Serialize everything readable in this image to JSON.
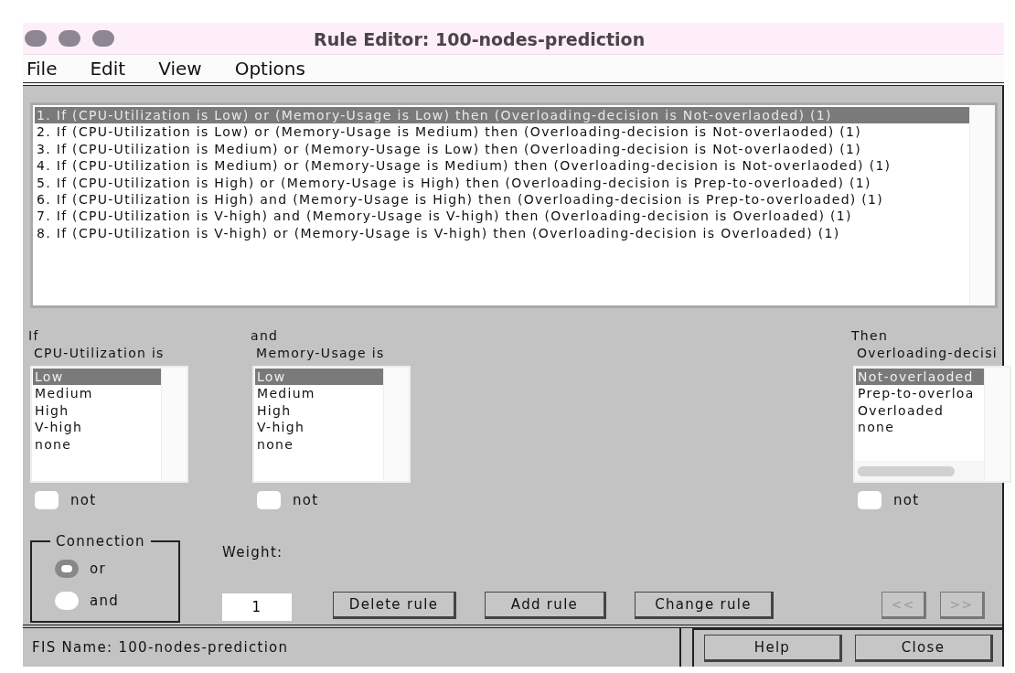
{
  "window": {
    "title": "Rule Editor: 100-nodes-prediction"
  },
  "menu": [
    "File",
    "Edit",
    "View",
    "Options"
  ],
  "rules": [
    {
      "text": "1. If (CPU-Utilization is Low) or (Memory-Usage is Low) then (Overloading-decision is Not-overlaoded) (1)",
      "selected": true
    },
    {
      "text": "2. If (CPU-Utilization is Low) or (Memory-Usage is Medium) then (Overloading-decision is Not-overlaoded) (1)",
      "selected": false
    },
    {
      "text": "3. If (CPU-Utilization is Medium) or (Memory-Usage is Low) then (Overloading-decision is Not-overlaoded) (1)",
      "selected": false
    },
    {
      "text": "4. If (CPU-Utilization is Medium) or (Memory-Usage is Medium) then (Overloading-decision is Not-overlaoded) (1)",
      "selected": false
    },
    {
      "text": "5. If (CPU-Utilization is High) or (Memory-Usage is High) then (Overloading-decision is Prep-to-overloaded) (1)",
      "selected": false
    },
    {
      "text": "6. If (CPU-Utilization is High) and (Memory-Usage is High) then (Overloading-decision is Prep-to-overloaded) (1)",
      "selected": false
    },
    {
      "text": "7. If (CPU-Utilization is V-high) and (Memory-Usage is V-high) then (Overloading-decision is Overloaded) (1)",
      "selected": false
    },
    {
      "text": "8. If (CPU-Utilization is V-high) or (Memory-Usage is V-high) then (Overloading-decision is Overloaded) (1)",
      "selected": false
    }
  ],
  "columns": [
    {
      "kind": "input",
      "heading": "If",
      "variable": "CPU-Utilization is",
      "options": [
        {
          "label": "Low",
          "selected": true
        },
        {
          "label": "Medium",
          "selected": false
        },
        {
          "label": "High",
          "selected": false
        },
        {
          "label": "V-high",
          "selected": false
        },
        {
          "label": "none",
          "selected": false
        }
      ],
      "not_label": "not",
      "not_checked": false
    },
    {
      "kind": "input",
      "heading": "and",
      "variable": "Memory-Usage is",
      "options": [
        {
          "label": "Low",
          "selected": true
        },
        {
          "label": "Medium",
          "selected": false
        },
        {
          "label": "High",
          "selected": false
        },
        {
          "label": "V-high",
          "selected": false
        },
        {
          "label": "none",
          "selected": false
        }
      ],
      "not_label": "not",
      "not_checked": false
    },
    {
      "kind": "output",
      "heading": "Then",
      "variable": "Overloading-decisi",
      "options": [
        {
          "label": "Not-overlaoded",
          "selected": true
        },
        {
          "label": "Prep-to-overloa",
          "selected": false
        },
        {
          "label": "Overloaded",
          "selected": false
        },
        {
          "label": "none",
          "selected": false
        }
      ],
      "not_label": "not",
      "not_checked": false
    }
  ],
  "connection": {
    "label": "Connection",
    "options": [
      {
        "label": "or",
        "selected": true
      },
      {
        "label": "and",
        "selected": false
      }
    ]
  },
  "weight": {
    "label": "Weight:",
    "value": "1"
  },
  "buttons": [
    "Delete rule",
    "Add rule",
    "Change rule"
  ],
  "nav_buttons": [
    {
      "label": "<<",
      "disabled": true
    },
    {
      "label": ">>",
      "disabled": true
    }
  ],
  "status": "FIS Name: 100-nodes-prediction",
  "footer_buttons": [
    "Help",
    "Close"
  ]
}
